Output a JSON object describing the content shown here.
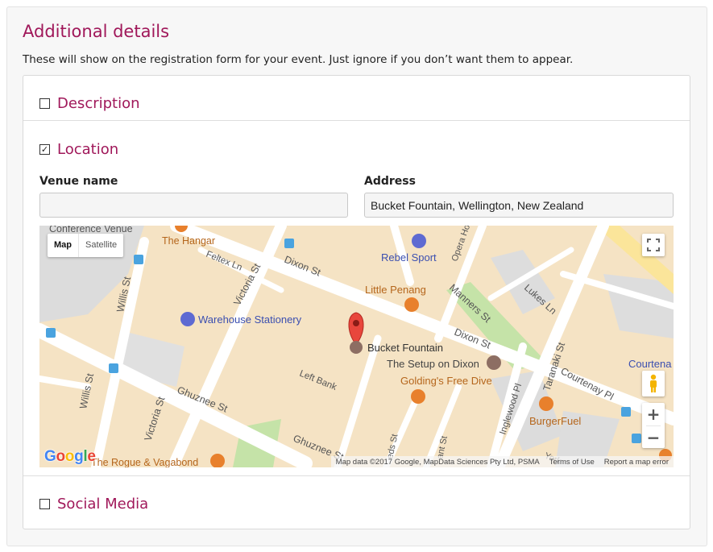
{
  "section": {
    "title": "Additional details",
    "intro": "These will show on the registration form for your event. Just ignore if you don’t want them to appear."
  },
  "rows": {
    "description": {
      "label": "Description",
      "checked": false
    },
    "location": {
      "label": "Location",
      "checked": true
    },
    "social": {
      "label": "Social Media",
      "checked": false
    }
  },
  "location_form": {
    "venue_label": "Venue name",
    "venue_value": "",
    "address_label": "Address",
    "address_value": "Bucket Fountain, Wellington, New Zealand"
  },
  "map": {
    "type_map": "Map",
    "type_satellite": "Satellite",
    "zoom_in": "+",
    "zoom_out": "−",
    "logo": "Google",
    "attribution": "Map data ©2017 Google, MapData Sciences Pty Ltd, PSMA",
    "terms": "Terms of Use",
    "report": "Report a map error",
    "pin_label": "Bucket Fountain",
    "colors": {
      "block": "#f5e3c4",
      "road": "#ffffff",
      "park": "#c5e3a8",
      "major_road": "#fbe59a",
      "pin": "#e8463c",
      "poi_food": "#e8802c",
      "poi_shop": "#5e6ad2",
      "poi_brown": "#8d6e63"
    },
    "labels": {
      "conference": "Conference Venue",
      "hangar": "The Hangar",
      "rebel": "Rebel Sport",
      "opera": "Opera House",
      "feltex": "Feltex Ln",
      "dixon1": "Dixon St",
      "dixon2": "Dixon St",
      "victoria1": "Victoria St",
      "victoria2": "Victoria St",
      "willis1": "Willis St",
      "willis2": "Willis St",
      "penang": "Little Penang",
      "manners": "Manners St",
      "lukes": "Lukes Ln",
      "warehouse": "Warehouse Stationery",
      "taranaki": "Taranaki St",
      "setup": "The Setup on Dixon",
      "courtena": "Courtena",
      "leftbank": "Left Bank",
      "goldings": "Golding's Free Dive",
      "courtenay": "Courtenay Pl",
      "ghuznee1": "Ghuznee St",
      "ghuznee2": "Ghuznee St",
      "inglewood": "Inglewood Pl",
      "burgerfuel": "BurgerFuel",
      "eds": "eds St",
      "ant": "ant St",
      "york": "York",
      "rogue": "The Rogue & Vagabond"
    }
  }
}
